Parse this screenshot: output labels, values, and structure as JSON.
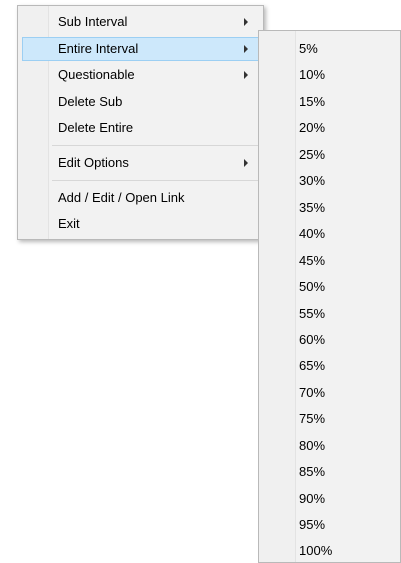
{
  "context_menu": {
    "items": [
      {
        "label": "Sub Interval",
        "has_submenu": true
      },
      {
        "label": "Entire Interval",
        "has_submenu": true,
        "highlighted": true
      },
      {
        "label": "Questionable",
        "has_submenu": true
      },
      {
        "label": "Delete Sub",
        "has_submenu": false
      },
      {
        "label": "Delete Entire",
        "has_submenu": false
      },
      {
        "label": "Edit Options",
        "has_submenu": true
      },
      {
        "label": "Add / Edit / Open Link",
        "has_submenu": false
      },
      {
        "label": "Exit",
        "has_submenu": false
      }
    ],
    "highlight_color": "#cde8fb",
    "arrow_icon": "chevron-right-icon"
  },
  "submenu": {
    "items": [
      "5%",
      "10%",
      "15%",
      "20%",
      "25%",
      "30%",
      "35%",
      "40%",
      "45%",
      "50%",
      "55%",
      "60%",
      "65%",
      "70%",
      "75%",
      "80%",
      "85%",
      "90%",
      "95%",
      "100%"
    ]
  }
}
